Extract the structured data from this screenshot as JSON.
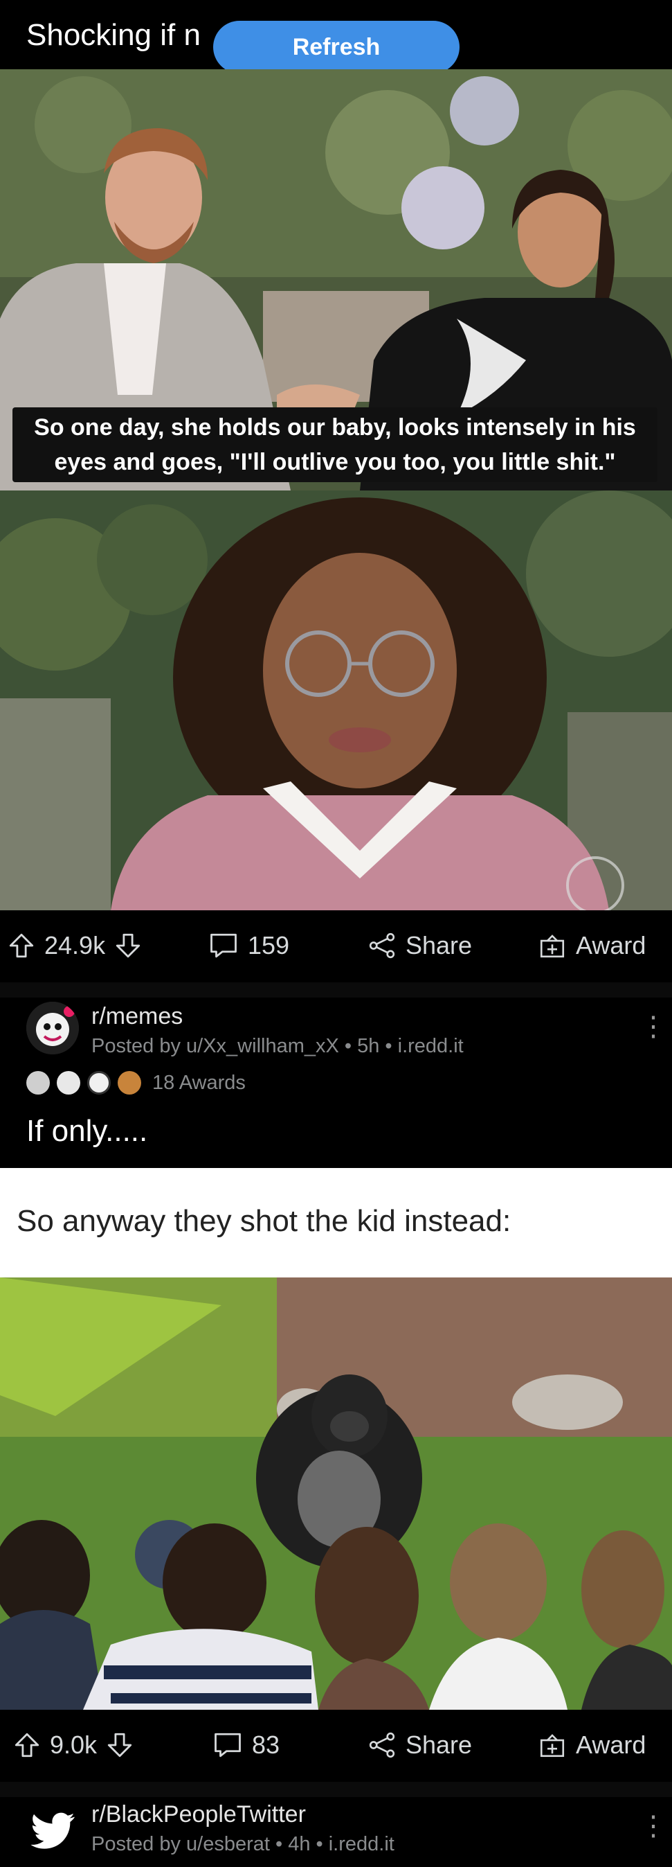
{
  "header": {
    "post_title": "Shocking if n",
    "refresh_label": "Refresh"
  },
  "post1": {
    "caption": "So one day, she holds our baby, looks intensely in his eyes and goes, \"I'll outlive you too, you little shit.\"",
    "upvotes": "24.9k",
    "comments": "159",
    "share_label": "Share",
    "award_label": "Award"
  },
  "post2": {
    "subreddit": "r/memes",
    "meta": "Posted by u/Xx_willham_xX • 5h • i.redd.it",
    "awards": "18 Awards",
    "title": "If only.....",
    "meme_text": "So anyway they shot the kid instead:",
    "upvotes": "9.0k",
    "comments": "83",
    "share_label": "Share",
    "award_label": "Award"
  },
  "post3": {
    "subreddit": "r/BlackPeopleTwitter",
    "meta": "Posted by u/esberat • 4h • i.redd.it"
  },
  "colors": {
    "accent": "#3f8fe6",
    "background": "#000000",
    "text_muted": "#8a8c8e"
  }
}
